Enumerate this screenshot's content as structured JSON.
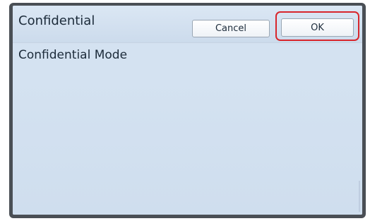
{
  "dialog": {
    "title": "Confidential",
    "cancel_label": "Cancel",
    "ok_label": "OK",
    "mode_label": "Confidential Mode"
  },
  "colors": {
    "screen_background": "#d4e2f1",
    "bezel": "#4a4f55",
    "highlight": "#d8262c"
  }
}
